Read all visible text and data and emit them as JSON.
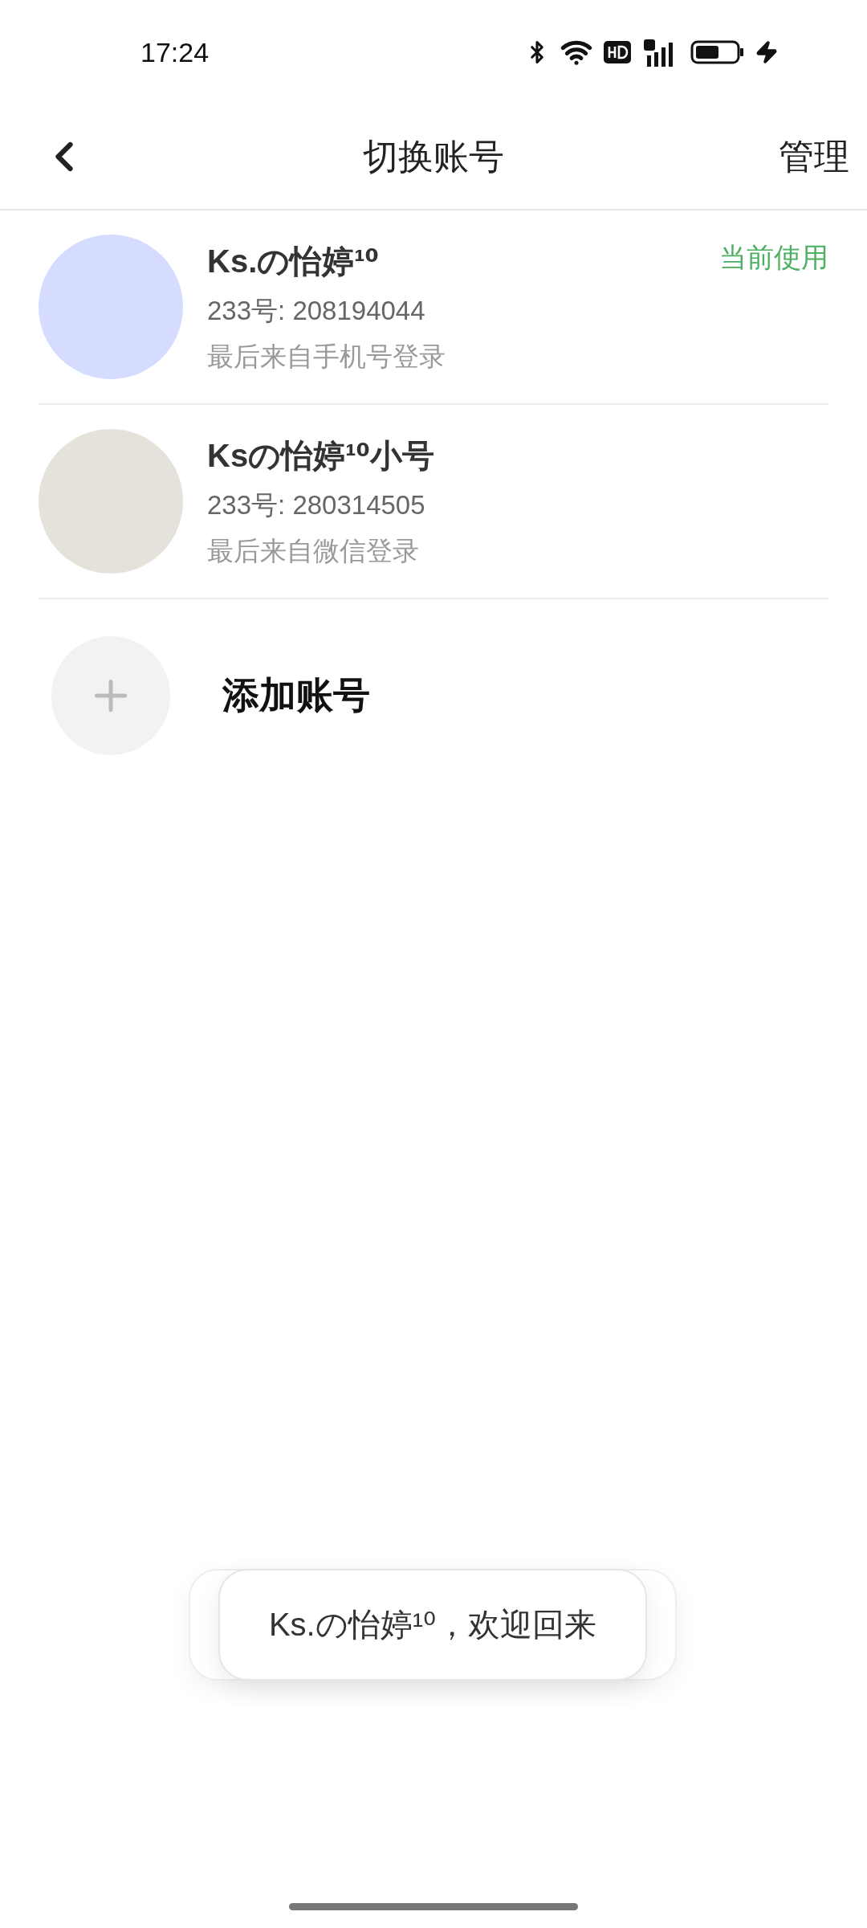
{
  "status_bar": {
    "time": "17:24"
  },
  "header": {
    "title": "切换账号",
    "action": "管理"
  },
  "accounts": [
    {
      "name": "Ks.の怡婷¹⁰",
      "id": "233号: 208194044",
      "login": "最后来自手机号登录",
      "current_label": "当前使用"
    },
    {
      "name": "Ksの怡婷¹⁰小号",
      "id": "233号: 280314505",
      "login": "最后来自微信登录"
    }
  ],
  "add_account": {
    "label": "添加账号"
  },
  "toast": {
    "text": "Ks.の怡婷¹⁰，欢迎回来"
  }
}
